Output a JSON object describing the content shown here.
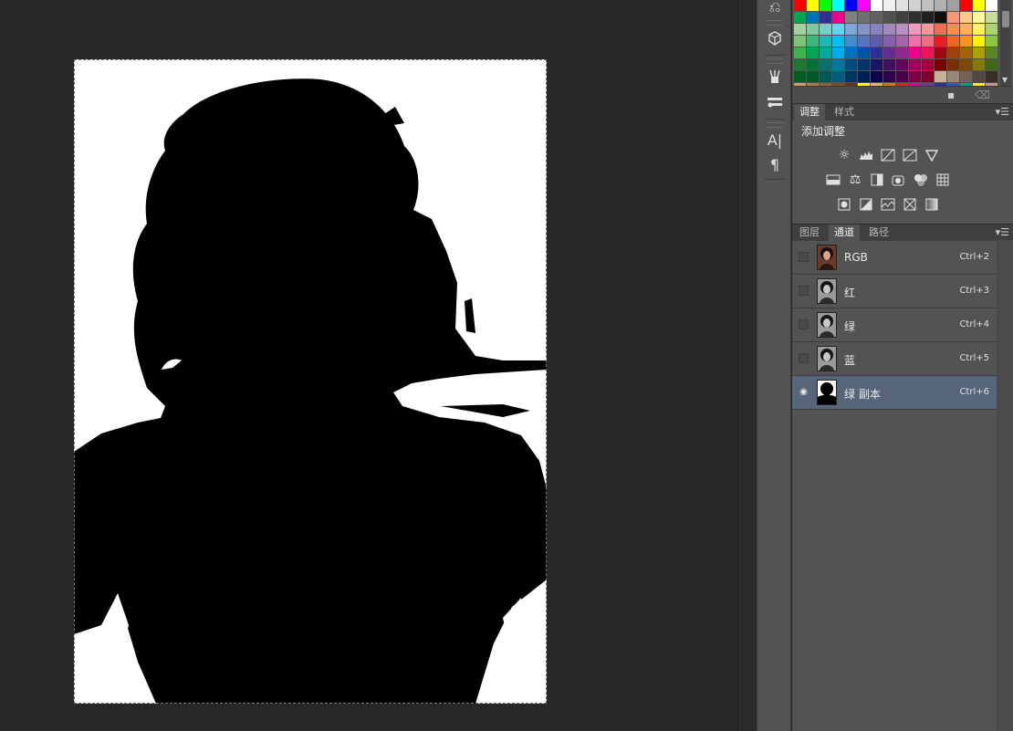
{
  "canvas": {
    "label": "image-canvas"
  },
  "swatches": {
    "colors": [
      "#ff0000",
      "#ffff00",
      "#00ff00",
      "#00ffff",
      "#0000ff",
      "#ff00ff",
      "#ffffff",
      "#f0f0f0",
      "#e0e0e0",
      "#d0d0d0",
      "#c0c0c0",
      "#b0b0b0",
      "#a0a0a0",
      "#ff0000",
      "#ffff00",
      "#ffffff",
      "#00a651",
      "#0072bc",
      "#2e3192",
      "#ec008c",
      "#808080",
      "#707070",
      "#606060",
      "#505050",
      "#404040",
      "#303030",
      "#202020",
      "#101010",
      "#f7977a",
      "#fdc68a",
      "#fff79a",
      "#c4df9b",
      "#a3d39c",
      "#82ca9d",
      "#7bcdc8",
      "#6ecff6",
      "#7ea7d8",
      "#8493ca",
      "#8882be",
      "#a187be",
      "#bc8dbf",
      "#f49ac2",
      "#f6989d",
      "#f26c4f",
      "#f68e55",
      "#fbaf5c",
      "#fff467",
      "#acd372",
      "#7cc576",
      "#3bb878",
      "#1abbb4",
      "#00bff3",
      "#438ccb",
      "#5574b9",
      "#605ca8",
      "#855fa8",
      "#a763a8",
      "#f06eaa",
      "#f26d7d",
      "#ed1c24",
      "#f26522",
      "#f7941d",
      "#fff200",
      "#8dc73f",
      "#39b54a",
      "#00a651",
      "#00a99d",
      "#00aeef",
      "#0072bc",
      "#0054a6",
      "#2e3192",
      "#662d91",
      "#92278f",
      "#ec008c",
      "#ed145b",
      "#9e0b0f",
      "#a0410d",
      "#a36209",
      "#aba000",
      "#598527",
      "#197b30",
      "#007236",
      "#00746b",
      "#0076a3",
      "#004b80",
      "#003471",
      "#1b1464",
      "#440e62",
      "#630460",
      "#9e005d",
      "#9e0039",
      "#790000",
      "#7b2e00",
      "#7d4900",
      "#827b00",
      "#406618",
      "#005e20",
      "#005826",
      "#005952",
      "#005b7f",
      "#003663",
      "#002157",
      "#0d004c",
      "#32004b",
      "#4b0049",
      "#7b0046",
      "#7a0026",
      "#c7b299",
      "#998675",
      "#736357",
      "#534741",
      "#37302a",
      "#c69c6d",
      "#a67c52",
      "#8c6239",
      "#754c24",
      "#603913",
      "#ffff00",
      "#fbaf5c",
      "#f26522",
      "#ed1c24",
      "#ec008c",
      "#92278f",
      "#2e3192",
      "#0072bc",
      "#00a651",
      "#fff200",
      "#c69c6d"
    ]
  },
  "adjustments_panel": {
    "tabs": [
      "调整",
      "样式"
    ],
    "title": "添加调整"
  },
  "channels_panel": {
    "tabs": [
      "图层",
      "通道",
      "路径"
    ],
    "rows": [
      {
        "name": "RGB",
        "shortcut": "Ctrl+2",
        "visible": false,
        "selected": false,
        "thumb": "color"
      },
      {
        "name": "红",
        "shortcut": "Ctrl+3",
        "visible": false,
        "selected": false,
        "thumb": "gray"
      },
      {
        "name": "绿",
        "shortcut": "Ctrl+4",
        "visible": false,
        "selected": false,
        "thumb": "gray"
      },
      {
        "name": "蓝",
        "shortcut": "Ctrl+5",
        "visible": false,
        "selected": false,
        "thumb": "gray"
      },
      {
        "name": "绿 副本",
        "shortcut": "Ctrl+6",
        "visible": true,
        "selected": true,
        "thumb": "mask"
      }
    ]
  },
  "toolstrip": {
    "tools": [
      "history-brush-icon",
      "3d-cube-icon",
      "brush-presets-icon",
      "tool-presets-icon",
      "character-icon",
      "paragraph-icon"
    ],
    "character_glyph": "A|",
    "paragraph_glyph": "¶"
  },
  "icons": {
    "eye": "👁",
    "panel_menu": "▾☰",
    "new_swatch": "▪",
    "trash": "🗑"
  }
}
